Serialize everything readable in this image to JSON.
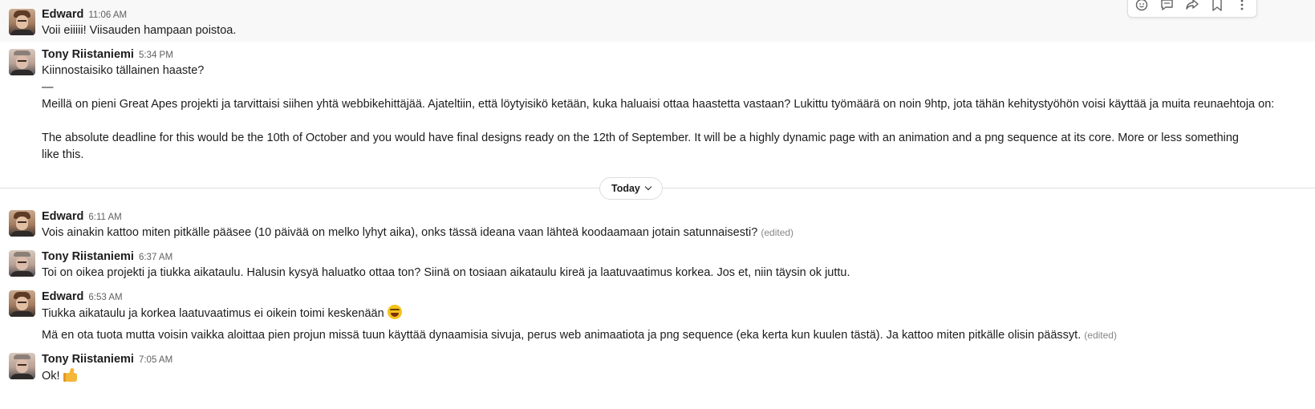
{
  "messages": [
    {
      "sender": "Edward",
      "time": "11:06 AM",
      "lines": [
        "Voii eiiiii! Viisauden hampaan poistoa."
      ]
    },
    {
      "sender": "Tony Riistaniemi",
      "time": "5:34 PM",
      "lines": [
        "Kiinnostaisiko tällainen haaste?",
        "—",
        "Meillä on pieni Great Apes projekti ja tarvittaisi siihen yhtä webbikehittäjää. Ajateltiin, että löytyisikö ketään, kuka haluaisi ottaa haastetta vastaan? Lukittu työmäärä on noin 9htp, jota tähän kehitystyöhön voisi käyttää ja muita reunaehtoja on:",
        "The absolute deadline for this would be the 10th of October and you would have final designs ready on the 12th of September. It will be a highly dynamic page with an animation and a png sequence at its core. More or less something like this."
      ]
    },
    {
      "sender": "Edward",
      "time": "6:11 AM",
      "lines": [
        "Vois ainakin kattoo miten pitkälle pääsee (10 päivää on melko lyhyt aika), onks tässä ideana vaan lähteä koodaamaan jotain satunnaisesti?"
      ],
      "edited": "(edited)"
    },
    {
      "sender": "Tony Riistaniemi",
      "time": "6:37 AM",
      "lines": [
        "Toi on oikea projekti ja tiukka aikataulu. Halusin kysyä haluatko ottaa ton? Siinä on tosiaan aikataulu kireä ja laatuvaatimus korkea. Jos et, niin täysin ok juttu."
      ]
    },
    {
      "sender": "Edward",
      "time": "6:53 AM",
      "lines": [
        "Tiukka aikataulu ja korkea laatuvaatimus ei oikein toimi keskenään",
        "Mä en ota tuota mutta voisin vaikka aloittaa pien projun missä tuun käyttää dynaamisia sivuja, perus web animaatiota ja png sequence (eka kerta kun kuulen tästä). Ja kattoo miten pitkälle olisin päässyt."
      ],
      "emoji": "laughing-emoji",
      "edited": "(edited)"
    },
    {
      "sender": "Tony Riistaniemi",
      "time": "7:05 AM",
      "lines": [
        "Ok!"
      ],
      "emoji": "thumbs-up-emoji"
    }
  ],
  "divider": {
    "label": "Today"
  },
  "toolbar": {
    "icons": [
      "add-reaction-icon",
      "reply-in-thread-icon",
      "share-message-icon",
      "save-bookmark-icon",
      "more-actions-icon"
    ]
  },
  "colors": {
    "text": "#1d1c1d",
    "timestamp": "#616061",
    "edited": "#868686",
    "hover_bg": "#f8f8f8",
    "divider": "#dddddd"
  }
}
